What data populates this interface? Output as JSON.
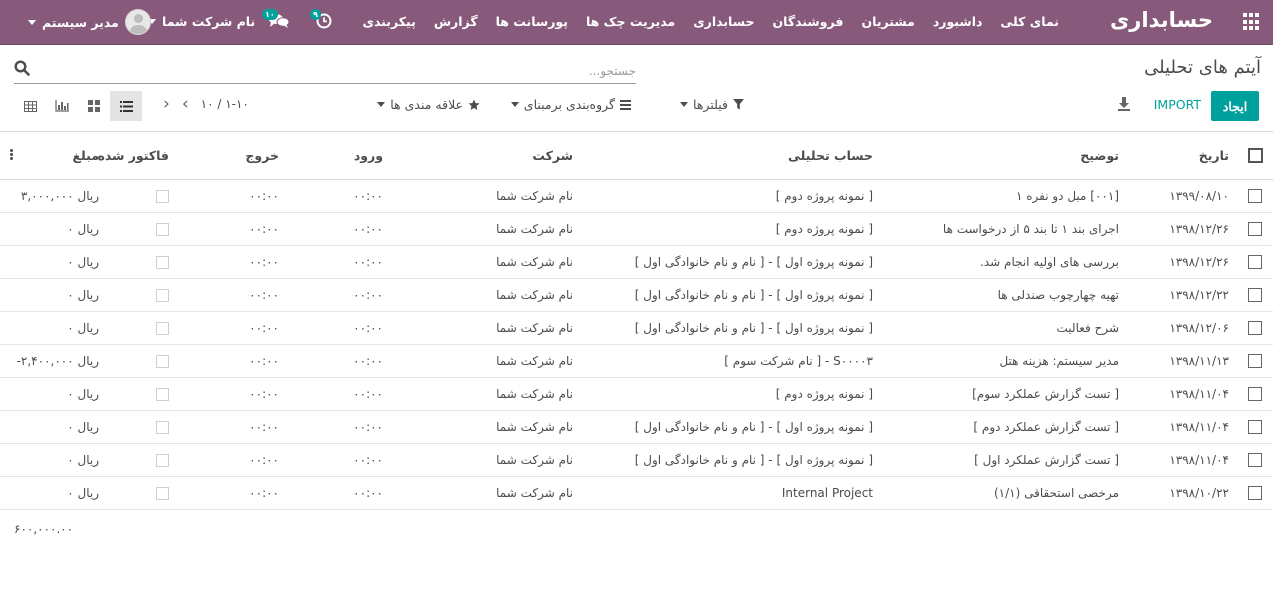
{
  "navbar": {
    "brand": "حسابداری",
    "menu": [
      "نمای کلی",
      "داشبورد",
      "مشتریان",
      "فروشندگان",
      "حسابداری",
      "مدیریت چک ها",
      "پورسانت ها",
      "گزارش",
      "پیکربندی"
    ],
    "activities_count": "۹",
    "messages_count": "۱۰",
    "company": "نام شرکت شما",
    "user": "مدیر سیستم",
    "color": "#875a7b"
  },
  "control": {
    "title": "آیتم های تحلیلی",
    "search_placeholder": "جستجو...",
    "create_label": "ایجاد",
    "import_label": "IMPORT",
    "filters_label": "فیلترها",
    "groupby_label": "گروه‌بندی برمبنای",
    "favorites_label": "علاقه مندی ها",
    "pager_value": "۱-۱۰ / ۱۰",
    "accent": "#00a09d"
  },
  "table": {
    "headers": {
      "date": "تاریخ",
      "description": "توضیح",
      "account": "حساب تحلیلی",
      "company": "شرکت",
      "in": "ورود",
      "out": "خروج",
      "invoiced": "فاکتور شده",
      "amount": "مبلغ"
    },
    "rows": [
      {
        "date": "۱۳۹۹/۰۸/۱۰",
        "description": "[۰۰۱] مبل دو نفره ۱",
        "account": "[ نمونه پروژه دوم ]",
        "company": "نام شرکت شما",
        "in": "۰۰:۰۰",
        "out": "۰۰:۰۰",
        "amount": "۳,۰۰۰,۰۰۰ ریال"
      },
      {
        "date": "۱۳۹۸/۱۲/۲۶",
        "description": "اجرای بند ۱ تا بند ۵ از درخواست ها",
        "account": "[ نمونه پروژه دوم ]",
        "company": "نام شرکت شما",
        "in": "۰۰:۰۰",
        "out": "۰۰:۰۰",
        "amount": "۰ ریال"
      },
      {
        "date": "۱۳۹۸/۱۲/۲۶",
        "description": "بررسی های اولیه انجام شد.",
        "account": "[ نمونه پروژه اول ] - [ نام و نام خانوادگی اول ]",
        "company": "نام شرکت شما",
        "in": "۰۰:۰۰",
        "out": "۰۰:۰۰",
        "amount": "۰ ریال"
      },
      {
        "date": "۱۳۹۸/۱۲/۲۲",
        "description": "تهیه چهارچوب صندلی ها",
        "account": "[ نمونه پروژه اول ] - [ نام و نام خانوادگی اول ]",
        "company": "نام شرکت شما",
        "in": "۰۰:۰۰",
        "out": "۰۰:۰۰",
        "amount": "۰ ریال"
      },
      {
        "date": "۱۳۹۸/۱۲/۰۶",
        "description": "شرح فعالیت",
        "account": "[ نمونه پروژه اول ] - [ نام و نام خانوادگی اول ]",
        "company": "نام شرکت شما",
        "in": "۰۰:۰۰",
        "out": "۰۰:۰۰",
        "amount": "۰ ریال"
      },
      {
        "date": "۱۳۹۸/۱۱/۱۳",
        "description": "مدیر سیستم: هزینه هتل",
        "account": "S۰۰۰۰۳ - [ نام شرکت سوم ]",
        "company": "نام شرکت شما",
        "in": "۰۰:۰۰",
        "out": "۰۰:۰۰",
        "amount": "-۲,۴۰۰,۰۰۰ ریال"
      },
      {
        "date": "۱۳۹۸/۱۱/۰۴",
        "description": "[ تست گزارش عملکرد سوم]",
        "account": "[ نمونه پروژه دوم ]",
        "company": "نام شرکت شما",
        "in": "۰۰:۰۰",
        "out": "۰۰:۰۰",
        "amount": "۰ ریال"
      },
      {
        "date": "۱۳۹۸/۱۱/۰۴",
        "description": "[ تست گزارش عملکرد دوم ]",
        "account": "[ نمونه پروژه اول ] - [ نام و نام خانوادگی اول ]",
        "company": "نام شرکت شما",
        "in": "۰۰:۰۰",
        "out": "۰۰:۰۰",
        "amount": "۰ ریال"
      },
      {
        "date": "۱۳۹۸/۱۱/۰۴",
        "description": "[ تست گزارش عملکرد اول ]",
        "account": "[ نمونه پروژه اول ] - [ نام و نام خانوادگی اول ]",
        "company": "نام شرکت شما",
        "in": "۰۰:۰۰",
        "out": "۰۰:۰۰",
        "amount": "۰ ریال"
      },
      {
        "date": "۱۳۹۸/۱۰/۲۲",
        "description": "مرخصی استحقاقی (۱/۱)",
        "account": "Internal Project",
        "company": "نام شرکت شما",
        "in": "۰۰:۰۰",
        "out": "۰۰:۰۰",
        "amount": "۰ ریال"
      }
    ],
    "total": "۶۰۰,۰۰۰.۰۰"
  }
}
